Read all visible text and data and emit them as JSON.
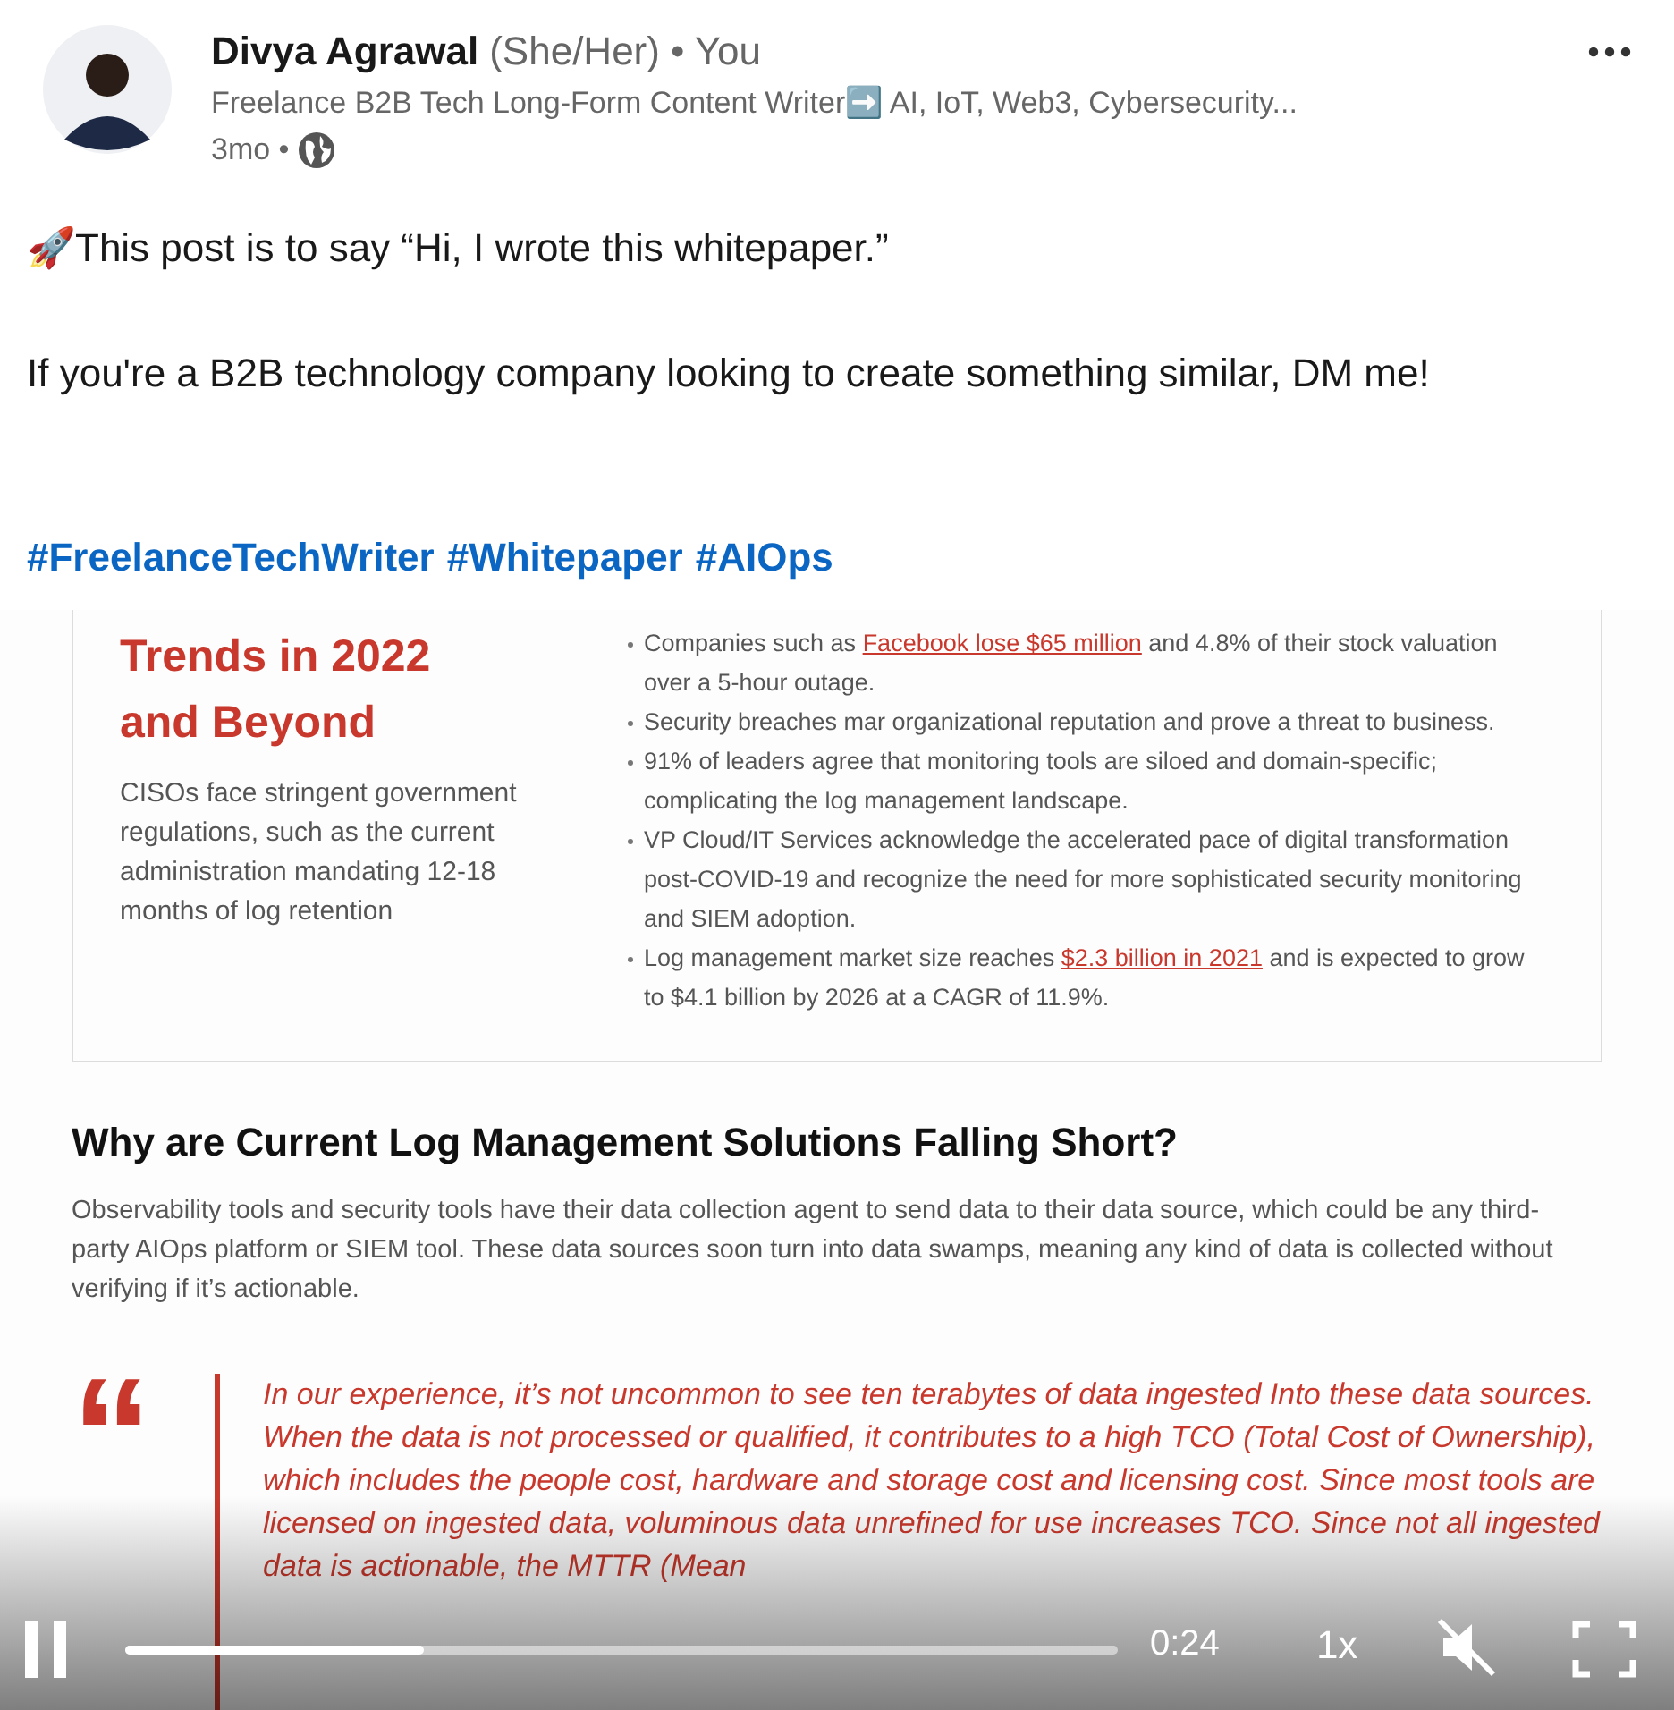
{
  "author": {
    "name": "Divya Agrawal",
    "pronouns": "(She/Her)",
    "relation": "• You",
    "headline": "Freelance B2B Tech Long-Form Content Writer➡️ AI, IoT, Web3, Cybersecurity...",
    "time": "3mo •"
  },
  "post": {
    "lines": [
      "🚀This post is to say “Hi, I wrote this whitepaper.”",
      "If you're a B2B technology company looking to create something similar, DM me!"
    ],
    "hashtags": [
      "#FreelanceTechWriter",
      "#Whitepaper",
      "#AIOps"
    ]
  },
  "document": {
    "title_lines": [
      "Trends in 2022",
      "and Beyond"
    ],
    "summary": "CISOs face stringent government regulations, such as the current administration mandating 12-18 months of log retention",
    "bullets": [
      {
        "parts": [
          {
            "kind": "plain",
            "text": "Companies such as "
          },
          {
            "kind": "link",
            "text": "Facebook lose $65 million"
          },
          {
            "kind": "plain",
            "text": " and 4.8% of their stock valuation over a 5-hour outage."
          }
        ]
      },
      {
        "parts": [
          {
            "kind": "plain",
            "text": "Security breaches mar organizational reputation and prove a threat to business."
          }
        ]
      },
      {
        "parts": [
          {
            "kind": "plain",
            "text": "91% of leaders agree that monitoring tools are siloed and domain-specific; complicating the log management landscape."
          }
        ]
      },
      {
        "parts": [
          {
            "kind": "plain",
            "text": "VP Cloud/IT Services acknowledge the accelerated pace of digital transformation post-COVID-19 and recognize the need for more sophisticated security monitoring and SIEM adoption."
          }
        ]
      },
      {
        "parts": [
          {
            "kind": "plain",
            "text": "Log management market size reaches "
          },
          {
            "kind": "link",
            "text": "$2.3 billion in 2021"
          },
          {
            "kind": "plain",
            "text": " and is expected to grow to $4.1 billion by 2026 at a CAGR of 11.9%."
          }
        ]
      }
    ],
    "heading": "Why are Current Log Management Solutions Falling Short?",
    "paragraph": "Observability tools and security tools have their data collection agent to send data to their data source, which could be any third-party AIOps platform or SIEM tool. These data sources soon turn into data swamps, meaning any kind of data is collected without verifying if it’s actionable.",
    "quote_mark": "“",
    "quote": "In our experience, it’s not uncommon to see ten terabytes of data ingested Into these data sources. When the data is not processed or qualified, it contributes to a high TCO (Total Cost of Ownership), which  includes the people cost, hardware and storage cost and licensing cost. Since most tools are licensed on ingested data, voluminous data unrefined for use increases TCO. Since not all ingested data is actionable, the MTTR (Mean"
  },
  "player": {
    "playing": true,
    "level": 0.3,
    "time": "0:24",
    "speed": "1x",
    "muted": true
  }
}
